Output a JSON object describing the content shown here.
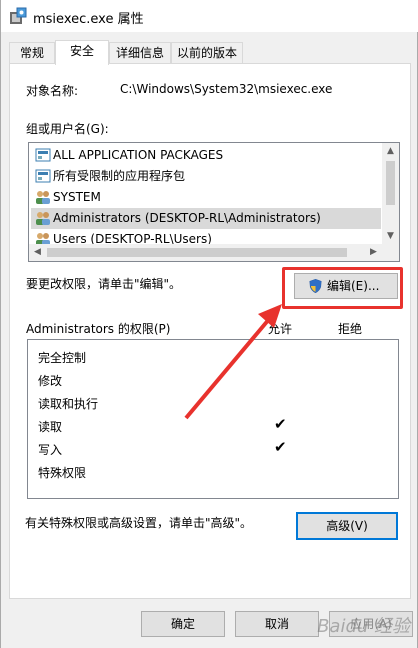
{
  "window": {
    "title": "msiexec.exe 属性"
  },
  "tabs": [
    {
      "label": "常规"
    },
    {
      "label": "安全"
    },
    {
      "label": "详细信息"
    },
    {
      "label": "以前的版本"
    }
  ],
  "object": {
    "label": "对象名称:",
    "value": "C:\\Windows\\System32\\msiexec.exe"
  },
  "groups": {
    "label": "组或用户名(G):",
    "items": [
      {
        "name": "ALL APPLICATION PACKAGES",
        "icon": "package-icon"
      },
      {
        "name": "所有受限制的应用程序包",
        "icon": "package-icon"
      },
      {
        "name": "SYSTEM",
        "icon": "users-icon"
      },
      {
        "name": "Administrators (DESKTOP-RL\\Administrators)",
        "icon": "users-icon"
      },
      {
        "name": "Users (DESKTOP-RL\\Users)",
        "icon": "users-icon"
      }
    ]
  },
  "change": {
    "text": "要更改权限，请单击\"编辑\"。",
    "edit_label": "编辑(E)..."
  },
  "permissions": {
    "label": "Administrators 的权限(P)",
    "allow_label": "允许",
    "deny_label": "拒绝",
    "rows": [
      {
        "name": "完全控制",
        "allow": false,
        "deny": false
      },
      {
        "name": "修改",
        "allow": false,
        "deny": false
      },
      {
        "name": "读取和执行",
        "allow": false,
        "deny": false
      },
      {
        "name": "读取",
        "allow": true,
        "deny": false
      },
      {
        "name": "写入",
        "allow": true,
        "deny": false
      },
      {
        "name": "特殊权限",
        "allow": false,
        "deny": false
      }
    ],
    "check_glyph": "✔"
  },
  "advanced": {
    "text": "有关特殊权限或高级设置，请单击\"高级\"。",
    "button_label": "高级(V)"
  },
  "footer": {
    "ok_label": "确定",
    "cancel_label": "取消",
    "apply_label": "应用(A)"
  },
  "watermark": "Baidu 经验",
  "colors": {
    "highlight": "#e8322d",
    "focus": "#0078d7"
  }
}
